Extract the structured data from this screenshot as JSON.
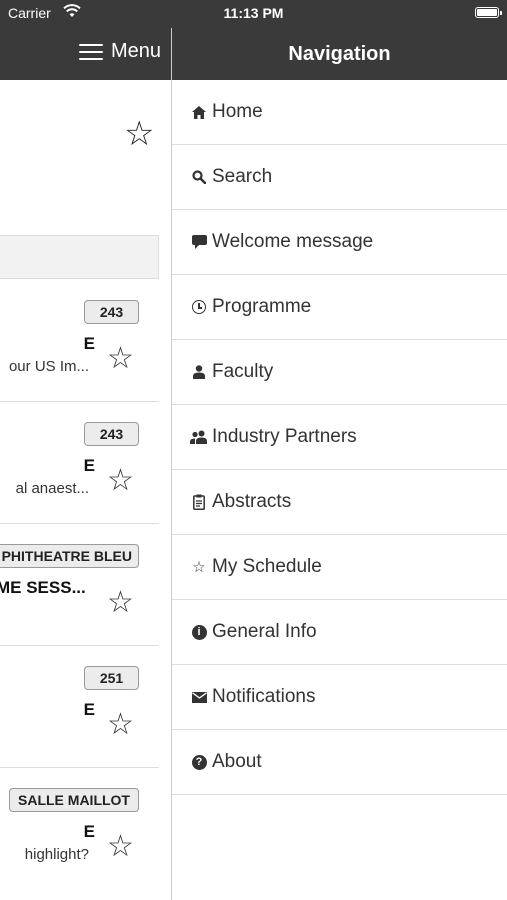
{
  "status_bar": {
    "carrier": "Carrier",
    "time": "11:13 PM"
  },
  "left_page": {
    "menu_label": "Menu",
    "sessions": [
      {
        "room": "243",
        "title": "E",
        "subtitle": "our US Im...",
        "room_cut": false
      },
      {
        "room": "243",
        "title": "E",
        "subtitle": "al anaest...",
        "room_cut": false
      },
      {
        "room": "PHITHEATRE BLEU",
        "title": "ME SESS...",
        "subtitle": "",
        "room_cut": true
      },
      {
        "room": "251",
        "title": "E",
        "subtitle": "",
        "room_cut": false
      },
      {
        "room": "SALLE MAILLOT",
        "title": "E",
        "subtitle": "highlight?",
        "room_cut": false
      }
    ]
  },
  "navigation": {
    "title": "Navigation",
    "items": [
      {
        "label": "Home",
        "icon": "home-icon"
      },
      {
        "label": "Search",
        "icon": "search-icon"
      },
      {
        "label": "Welcome message",
        "icon": "speech-bubble-icon"
      },
      {
        "label": "Programme",
        "icon": "clock-icon"
      },
      {
        "label": "Faculty",
        "icon": "person-icon"
      },
      {
        "label": "Industry Partners",
        "icon": "group-icon"
      },
      {
        "label": "Abstracts",
        "icon": "clipboard-icon"
      },
      {
        "label": "My Schedule",
        "icon": "star-icon"
      },
      {
        "label": "General Info",
        "icon": "info-icon"
      },
      {
        "label": "Notifications",
        "icon": "envelope-icon"
      },
      {
        "label": "About",
        "icon": "question-icon"
      }
    ]
  }
}
